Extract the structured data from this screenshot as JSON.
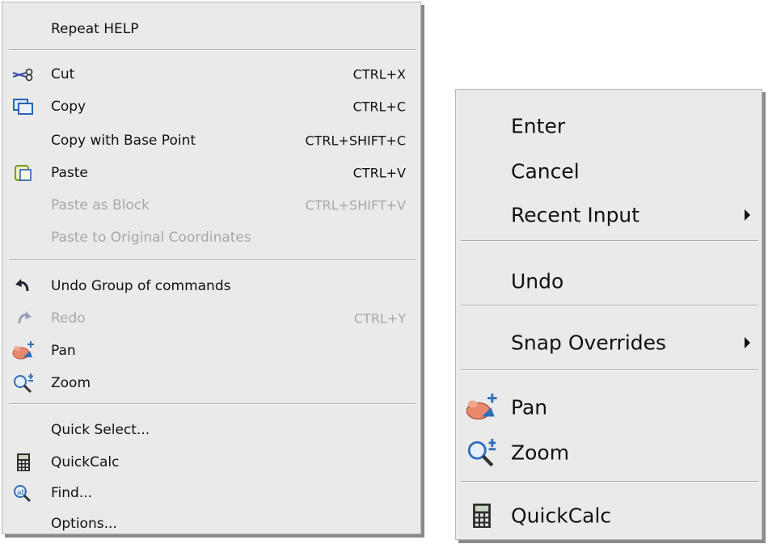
{
  "left_menu": {
    "repeat": "Repeat HELP",
    "cut": {
      "label": "Cut",
      "shortcut": "CTRL+X",
      "icon": "scissors-icon"
    },
    "copy": {
      "label": "Copy",
      "shortcut": "CTRL+C",
      "icon": "copy-icon"
    },
    "copy_base": {
      "label": "Copy with Base Point",
      "shortcut": "CTRL+SHIFT+C"
    },
    "paste": {
      "label": "Paste",
      "shortcut": "CTRL+V",
      "icon": "paste-icon"
    },
    "paste_block": {
      "label": "Paste as Block",
      "shortcut": "CTRL+SHIFT+V"
    },
    "paste_orig": {
      "label": "Paste to Original Coordinates"
    },
    "undo": {
      "label": "Undo Group of commands",
      "icon": "undo-icon"
    },
    "redo": {
      "label": "Redo",
      "shortcut": "CTRL+Y",
      "icon": "redo-icon"
    },
    "pan": {
      "label": "Pan",
      "icon": "pan-hand-icon"
    },
    "zoom": {
      "label": "Zoom",
      "icon": "zoom-magnifier-icon"
    },
    "quick_select": {
      "label": "Quick Select..."
    },
    "quickcalc": {
      "label": "QuickCalc",
      "icon": "calculator-icon"
    },
    "find": {
      "label": "Find...",
      "icon": "find-icon"
    },
    "options": {
      "label": "Options..."
    }
  },
  "right_menu": {
    "enter": {
      "label": "Enter"
    },
    "cancel": {
      "label": "Cancel"
    },
    "recent_input": {
      "label": "Recent Input",
      "submenu": true
    },
    "undo": {
      "label": "Undo"
    },
    "snap_overrides": {
      "label": "Snap Overrides",
      "submenu": true
    },
    "pan": {
      "label": "Pan",
      "icon": "pan-hand-icon"
    },
    "zoom": {
      "label": "Zoom",
      "icon": "zoom-magnifier-icon"
    },
    "quickcalc": {
      "label": "QuickCalc",
      "icon": "calculator-icon"
    }
  },
  "colors": {
    "menu_bg": "#eaeaea",
    "disabled_text": "#a8a8a8",
    "separator": "#a9a9a9"
  }
}
